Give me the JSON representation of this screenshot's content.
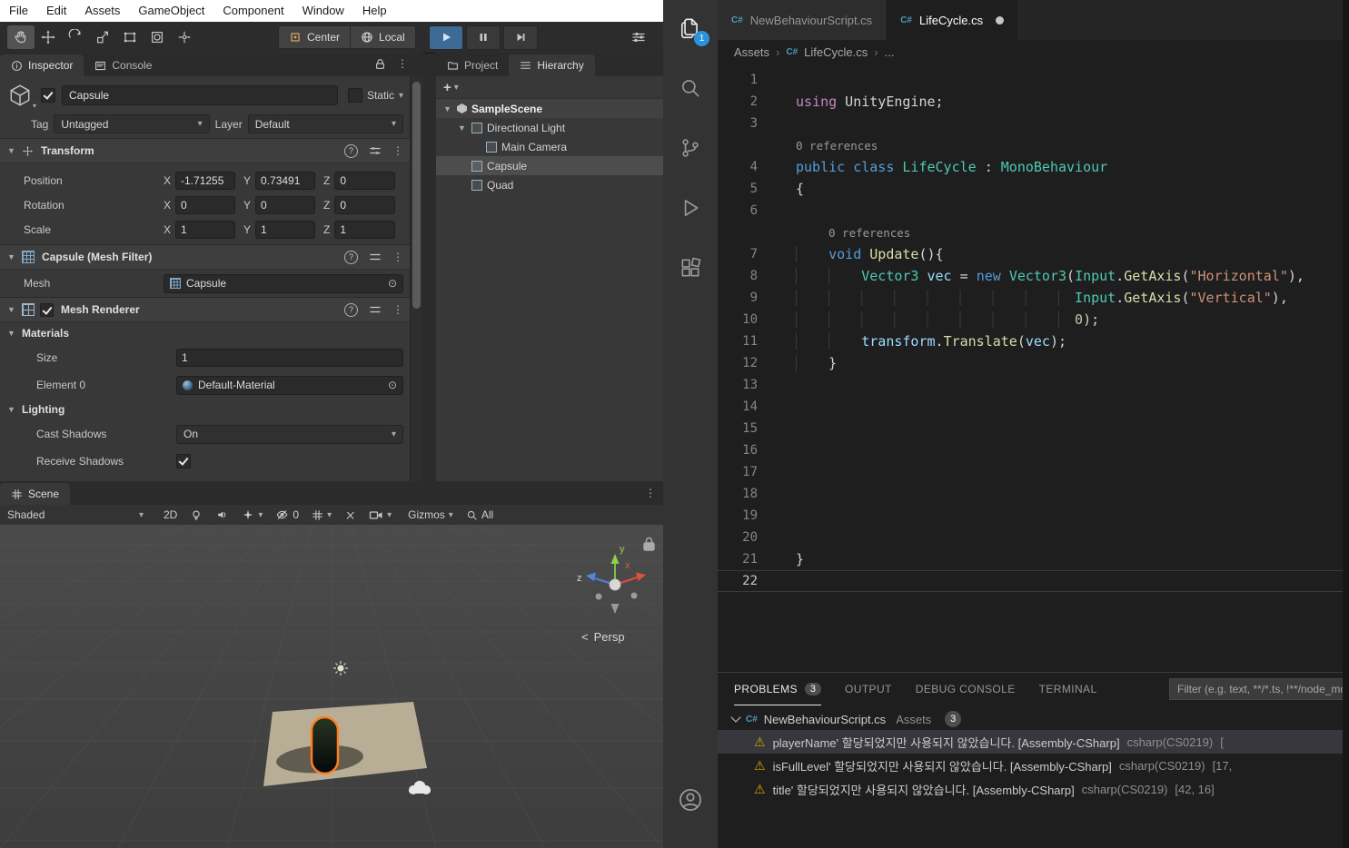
{
  "colors": {
    "play_active": "#3e6a96",
    "badge_blue": "#2b93dd"
  },
  "icons": {
    "fold_open": "▼",
    "dropdown": "▾",
    "picker": "⊙",
    "kebab": "⋮",
    "plus": "+",
    "chevron": "›",
    "question": "?",
    "csharp": "C#",
    "warning": "⚠",
    "chevron_left": "<"
  },
  "unity": {
    "menu": [
      "File",
      "Edit",
      "Assets",
      "GameObject",
      "Component",
      "Window",
      "Help"
    ],
    "toolbar": {
      "pivot_label": "Center",
      "space_label": "Local"
    },
    "inspector": {
      "tab_inspector": "Inspector",
      "tab_console": "Console",
      "go_name": "Capsule",
      "static_label": "Static",
      "tag_label": "Tag",
      "tag_value": "Untagged",
      "layer_label": "Layer",
      "layer_value": "Default",
      "axes": [
        "X",
        "Y",
        "Z"
      ],
      "transform": {
        "title": "Transform",
        "rows": [
          {
            "label": "Position",
            "x": "-1.71255",
            "y": "0.73491",
            "z": "0"
          },
          {
            "label": "Rotation",
            "x": "0",
            "y": "0",
            "z": "0"
          },
          {
            "label": "Scale",
            "x": "1",
            "y": "1",
            "z": "1"
          }
        ]
      },
      "mesh_filter": {
        "title": "Capsule (Mesh Filter)",
        "mesh_label": "Mesh",
        "mesh_value": "Capsule"
      },
      "mesh_renderer": {
        "title": "Mesh Renderer",
        "materials_label": "Materials",
        "size_label": "Size",
        "size_value": "1",
        "element_label": "Element 0",
        "element_value": "Default-Material",
        "lighting_label": "Lighting",
        "cast_label": "Cast Shadows",
        "cast_value": "On",
        "receive_label": "Receive Shadows"
      }
    },
    "panel_tabs": {
      "project": "Project",
      "hierarchy": "Hierarchy"
    },
    "hierarchy": [
      {
        "label": "SampleScene",
        "depth": 0,
        "fold": true,
        "icon": "scene",
        "header": true
      },
      {
        "label": "Directional Light",
        "depth": 1,
        "fold": true,
        "icon": "go"
      },
      {
        "label": "Main Camera",
        "depth": 2,
        "fold": false,
        "icon": "go"
      },
      {
        "label": "Capsule",
        "depth": 1,
        "fold": false,
        "icon": "go",
        "selected": true
      },
      {
        "label": "Quad",
        "depth": 1,
        "fold": false,
        "icon": "go"
      }
    ],
    "scene": {
      "tab": "Scene",
      "shading": "Shaded",
      "mode2d": "2D",
      "hidden_count": "0",
      "gizmos_label": "Gizmos",
      "search_value": "All",
      "persp": "Persp",
      "axis": {
        "x": "x",
        "y": "y",
        "z": "z"
      }
    }
  },
  "vscode": {
    "activity_badge": "1",
    "tabs": [
      {
        "label": "NewBehaviourScript.cs",
        "active": false,
        "modified": false
      },
      {
        "label": "LifeCycle.cs",
        "active": true,
        "modified": true
      }
    ],
    "breadcrumb": {
      "root": "Assets",
      "file": "LifeCycle.cs",
      "more": "..."
    },
    "editor": {
      "rows": [
        {
          "n": "1",
          "tokens": []
        },
        {
          "n": "2",
          "tokens": [
            [
              "pk",
              "using"
            ],
            [
              "tx",
              " UnityEngine;"
            ]
          ]
        },
        {
          "n": "3",
          "tokens": []
        },
        {
          "lens": "0 references",
          "indent": 0
        },
        {
          "n": "4",
          "tokens": [
            [
              "bl",
              "public"
            ],
            [
              "tx",
              " "
            ],
            [
              "bl",
              "class"
            ],
            [
              "tx",
              " "
            ],
            [
              "tl",
              "LifeCycle"
            ],
            [
              "tx",
              " : "
            ],
            [
              "tl",
              "MonoBehaviour"
            ]
          ]
        },
        {
          "n": "5",
          "tokens": [
            [
              "tx",
              "{"
            ]
          ]
        },
        {
          "n": "6",
          "tokens": []
        },
        {
          "lens": "0 references",
          "indent": 4
        },
        {
          "n": "7",
          "tokens": [
            [
              "ws",
              "    "
            ],
            [
              "bl",
              "void"
            ],
            [
              "tx",
              " "
            ],
            [
              "yl",
              "Update"
            ],
            [
              "tx",
              "(){"
            ]
          ]
        },
        {
          "n": "8",
          "tokens": [
            [
              "ws",
              "        "
            ],
            [
              "tl",
              "Vector3"
            ],
            [
              "tx",
              " "
            ],
            [
              "lb",
              "vec"
            ],
            [
              "tx",
              " = "
            ],
            [
              "bl",
              "new"
            ],
            [
              "tx",
              " "
            ],
            [
              "tl",
              "Vector3"
            ],
            [
              "tx",
              "("
            ],
            [
              "tl",
              "Input"
            ],
            [
              "tx",
              "."
            ],
            [
              "yl",
              "GetAxis"
            ],
            [
              "tx",
              "("
            ],
            [
              "st",
              "\"Horizontal\""
            ],
            [
              "tx",
              "),"
            ]
          ]
        },
        {
          "n": "9",
          "tokens": [
            [
              "ws",
              "                                  "
            ],
            [
              "tl",
              "Input"
            ],
            [
              "tx",
              "."
            ],
            [
              "yl",
              "GetAxis"
            ],
            [
              "tx",
              "("
            ],
            [
              "st",
              "\"Vertical\""
            ],
            [
              "tx",
              "),"
            ]
          ]
        },
        {
          "n": "10",
          "tokens": [
            [
              "ws",
              "                                  "
            ],
            [
              "nm",
              "0"
            ],
            [
              "tx",
              ");"
            ]
          ]
        },
        {
          "n": "11",
          "tokens": [
            [
              "ws",
              "        "
            ],
            [
              "lb",
              "transform"
            ],
            [
              "tx",
              "."
            ],
            [
              "yl",
              "Translate"
            ],
            [
              "tx",
              "("
            ],
            [
              "lb",
              "vec"
            ],
            [
              "tx",
              ");"
            ]
          ]
        },
        {
          "n": "12",
          "tokens": [
            [
              "ws",
              "    "
            ],
            [
              "tx",
              "}"
            ]
          ]
        },
        {
          "n": "13",
          "tokens": []
        },
        {
          "n": "14",
          "tokens": []
        },
        {
          "n": "15",
          "tokens": []
        },
        {
          "n": "16",
          "tokens": []
        },
        {
          "n": "17",
          "tokens": []
        },
        {
          "n": "18",
          "tokens": []
        },
        {
          "n": "19",
          "tokens": []
        },
        {
          "n": "20",
          "tokens": []
        },
        {
          "n": "21",
          "tokens": [
            [
              "tx",
              "}"
            ]
          ]
        },
        {
          "n": "22",
          "tokens": [],
          "cur": true
        }
      ]
    },
    "panel": {
      "tabs": [
        {
          "label": "PROBLEMS",
          "active": true,
          "badge": "3"
        },
        {
          "label": "OUTPUT",
          "active": false
        },
        {
          "label": "DEBUG CONSOLE",
          "active": false
        },
        {
          "label": "TERMINAL",
          "active": false
        }
      ],
      "filter_placeholder": "Filter (e.g. text, **/*.ts, !**/node_modules/**)",
      "group": {
        "file": "NewBehaviourScript.cs",
        "path": "Assets",
        "count": "3"
      },
      "problems": [
        {
          "message": "playerName' 할당되었지만 사용되지 않았습니다. [Assembly-CSharp]",
          "source": "csharp(CS0219)",
          "pos": "[",
          "selected": true
        },
        {
          "message": "isFullLevel' 할당되었지만 사용되지 않았습니다. [Assembly-CSharp]",
          "source": "csharp(CS0219)",
          "pos": "[17,",
          "selected": false
        },
        {
          "message": "title' 할당되었지만 사용되지 않았습니다. [Assembly-CSharp]",
          "source": "csharp(CS0219)",
          "pos": "[42, 16]",
          "selected": false
        }
      ]
    }
  }
}
